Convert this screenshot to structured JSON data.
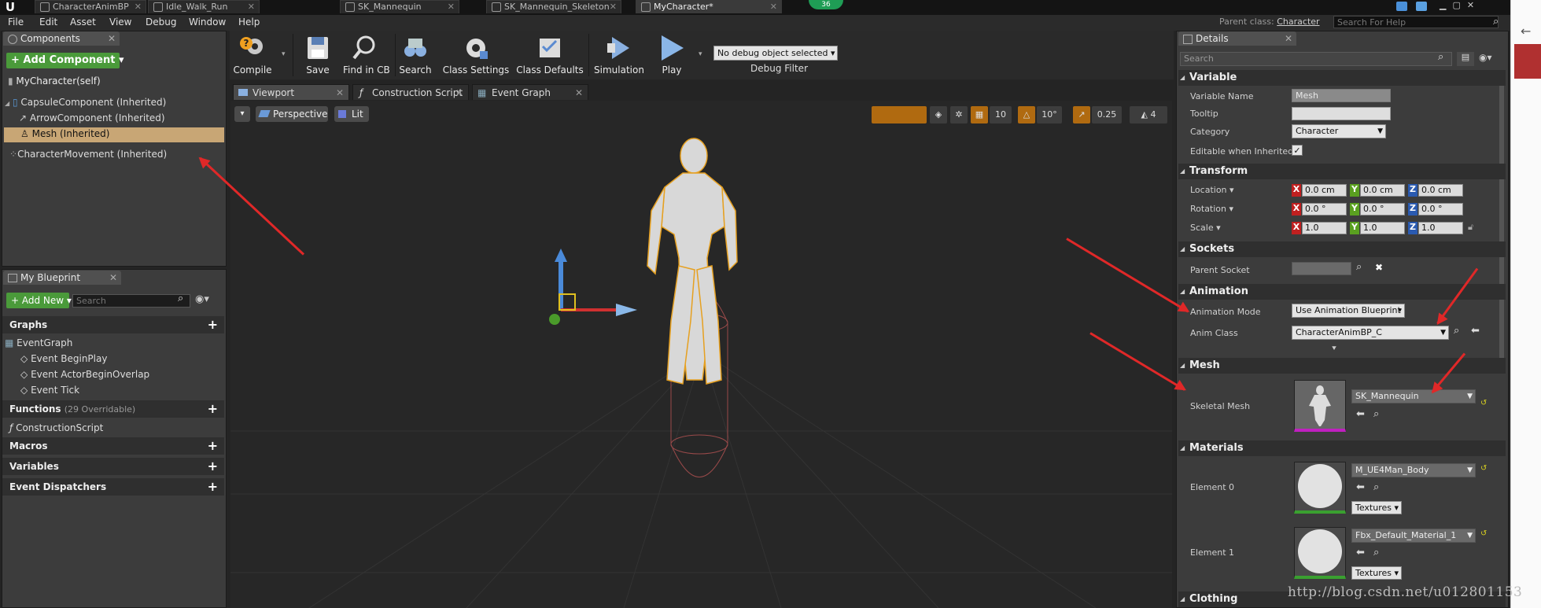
{
  "doc_tabs": [
    "CharacterAnimBP",
    "Idle_Walk_Run",
    "SK_Mannequin",
    "SK_Mannequin_Skeleton",
    "MyCharacter*"
  ],
  "badge": "36",
  "menu": [
    "File",
    "Edit",
    "Asset",
    "View",
    "Debug",
    "Window",
    "Help"
  ],
  "parent_class": {
    "label": "Parent class:",
    "value": "Character"
  },
  "help_search_placeholder": "Search For Help",
  "components": {
    "tab": "Components",
    "add_button": "+ Add Component ▾",
    "self_item": "MyCharacter(self)",
    "items": [
      "CapsuleComponent (Inherited)",
      "ArrowComponent (Inherited)",
      "Mesh (Inherited)",
      "CharacterMovement (Inherited)"
    ],
    "selected": "Mesh (Inherited)"
  },
  "my_blueprint": {
    "tab": "My Blueprint",
    "add_new": "+ Add New ▾",
    "search_placeholder": "Search",
    "graphs_header": "Graphs",
    "event_graph": "EventGraph",
    "events": [
      "Event BeginPlay",
      "Event ActorBeginOverlap",
      "Event Tick"
    ],
    "functions_header": "Functions",
    "functions_count": "(29 Overridable)",
    "construction_script": "ConstructionScript",
    "macros": "Macros",
    "variables": "Variables",
    "event_dispatchers": "Event Dispatchers"
  },
  "toolbar": {
    "buttons": [
      "Compile",
      "Save",
      "Find in CB",
      "Search",
      "Class Settings",
      "Class Defaults",
      "Simulation",
      "Play"
    ],
    "debug_select": "No debug object selected ▾",
    "debug_filter": "Debug Filter"
  },
  "graph_tabs": [
    "Viewport",
    "Construction Script",
    "Event Graph"
  ],
  "viewport": {
    "perspective": "Perspective",
    "lit": "Lit",
    "grid_snap": "10",
    "rotation_snap": "10°",
    "scale_snap": "0.25",
    "camera_speed": "4"
  },
  "details": {
    "tab": "Details",
    "search_placeholder": "Search",
    "variable": {
      "header": "Variable",
      "name_label": "Variable Name",
      "name_value": "Mesh",
      "tooltip_label": "Tooltip",
      "tooltip_value": "",
      "category_label": "Category",
      "category_value": "Character",
      "editable_label": "Editable when Inherited",
      "editable_checked": true
    },
    "transform": {
      "header": "Transform",
      "location_label": "Location ▾",
      "location": [
        "0.0 cm",
        "0.0 cm",
        "0.0 cm"
      ],
      "rotation_label": "Rotation ▾",
      "rotation": [
        "0.0 °",
        "0.0 °",
        "0.0 °"
      ],
      "scale_label": "Scale ▾",
      "scale": [
        "1.0",
        "1.0",
        "1.0"
      ]
    },
    "sockets": {
      "header": "Sockets",
      "parent_socket_label": "Parent Socket",
      "parent_socket_value": ""
    },
    "animation": {
      "header": "Animation",
      "mode_label": "Animation Mode",
      "mode_value": "Use Animation Blueprint",
      "class_label": "Anim Class",
      "class_value": "CharacterAnimBP_C"
    },
    "mesh": {
      "header": "Mesh",
      "skeletal_label": "Skeletal Mesh",
      "skeletal_value": "SK_Mannequin"
    },
    "materials": {
      "header": "Materials",
      "elements": [
        {
          "label": "Element 0",
          "value": "M_UE4Man_Body",
          "textures": "Textures ▾"
        },
        {
          "label": "Element 1",
          "value": "Fbx_Default_Material_1",
          "textures": "Textures ▾"
        }
      ]
    },
    "clothing_header": "Clothing"
  },
  "watermark": "http://blog.csdn.net/u012801153"
}
